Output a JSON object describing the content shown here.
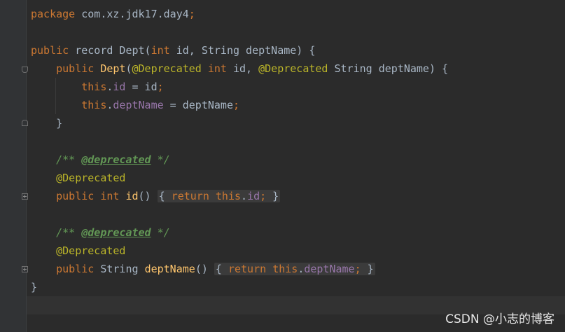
{
  "code": {
    "l1": [
      "package",
      " com.xz.jdk17.day4",
      ";"
    ],
    "l3": [
      "public",
      " ",
      "record",
      " Dept(",
      "int",
      " id, String deptName) {"
    ],
    "l4": [
      "    ",
      "public",
      " ",
      "Dept",
      "(",
      "@Deprecated",
      " ",
      "int",
      " id, ",
      "@Deprecated",
      " String deptName) {"
    ],
    "l5": [
      "        ",
      "this",
      ".",
      "id",
      " = id",
      ";"
    ],
    "l6": [
      "        ",
      "this",
      ".",
      "deptName",
      " = deptName",
      ";"
    ],
    "l7": [
      "    }"
    ],
    "l9": [
      "    ",
      "/** ",
      "@deprecated",
      " */"
    ],
    "l10": [
      "    ",
      "@Deprecated"
    ],
    "l11": [
      "    ",
      "public",
      " ",
      "int",
      " ",
      "id",
      "()",
      " ",
      "{ ",
      "return",
      " ",
      "this",
      ".",
      "id",
      ";",
      " }"
    ],
    "l13": [
      "    ",
      "/** ",
      "@deprecated",
      " */"
    ],
    "l14": [
      "    ",
      "@Deprecated"
    ],
    "l15": [
      "    ",
      "public",
      " String ",
      "deptName",
      "()",
      " ",
      "{ ",
      "return",
      " ",
      "this",
      ".",
      "deptName",
      ";",
      " }"
    ],
    "l16": [
      "}"
    ]
  },
  "watermark": "CSDN @小志的博客",
  "colors": {
    "background": "#2b2b2b",
    "keyword": "#cc7832",
    "annotation": "#bbb529",
    "field": "#9876aa",
    "method": "#ffc66d",
    "comment": "#629755",
    "text": "#a9b7c6"
  }
}
